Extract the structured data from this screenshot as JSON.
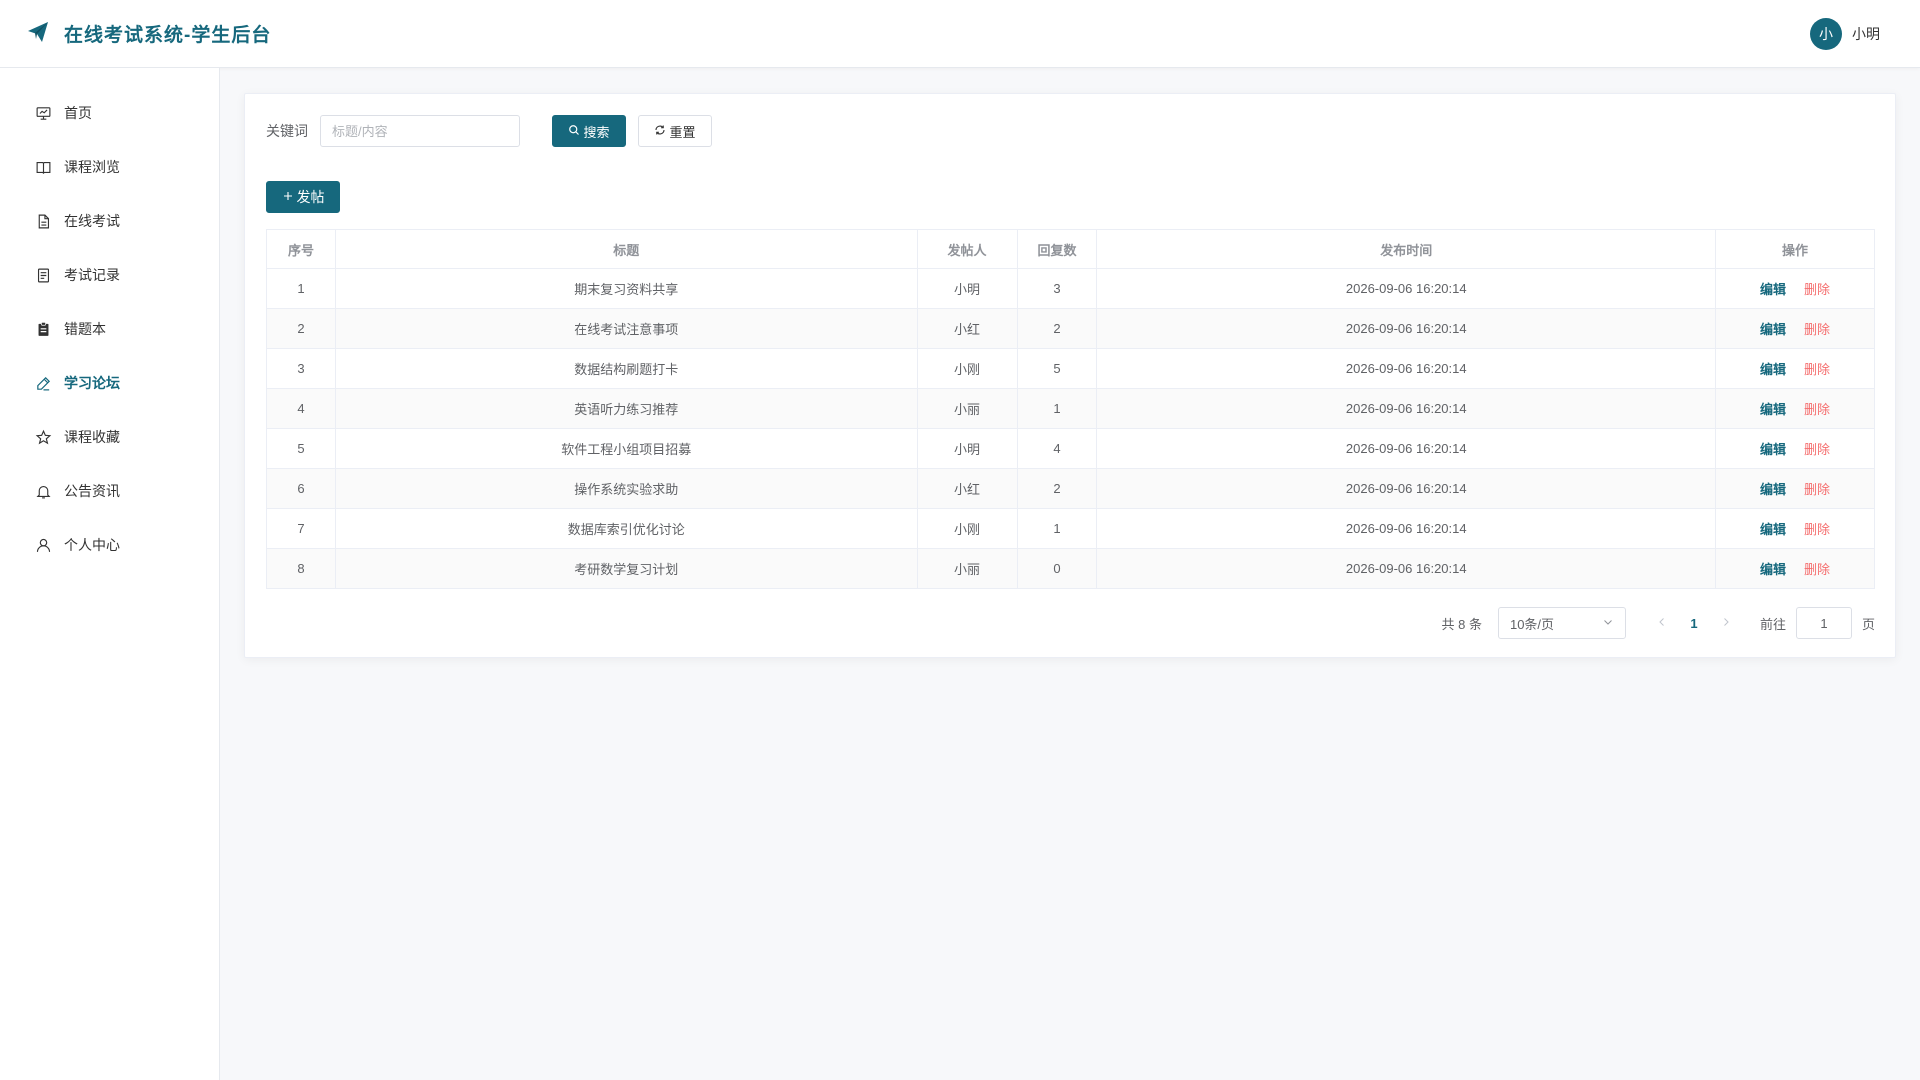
{
  "header": {
    "title": "在线考试系统-学生后台",
    "avatar_text": "小",
    "user_name": "小明"
  },
  "sidebar": {
    "items": [
      {
        "label": "首页",
        "icon": "home-icon"
      },
      {
        "label": "课程浏览",
        "icon": "book-icon"
      },
      {
        "label": "在线考试",
        "icon": "document-icon"
      },
      {
        "label": "考试记录",
        "icon": "record-icon"
      },
      {
        "label": "错题本",
        "icon": "notebook-icon"
      },
      {
        "label": "学习论坛",
        "icon": "pen-icon",
        "active": true
      },
      {
        "label": "课程收藏",
        "icon": "star-icon"
      },
      {
        "label": "公告资讯",
        "icon": "bell-icon"
      },
      {
        "label": "个人中心",
        "icon": "user-icon"
      }
    ]
  },
  "search": {
    "label": "关键词",
    "placeholder": "标题/内容",
    "value": "",
    "search_label": "搜索",
    "reset_label": "重置"
  },
  "toolbar": {
    "post_label": "发帖"
  },
  "table": {
    "columns": [
      "序号",
      "标题",
      "发帖人",
      "回复数",
      "发布时间",
      "操作"
    ],
    "edit_label": "编辑",
    "delete_label": "删除",
    "rows": [
      {
        "idx": "1",
        "title": "期末复习资料共享",
        "author": "小明",
        "replies": "3",
        "time": "2026-09-06 16:20:14"
      },
      {
        "idx": "2",
        "title": "在线考试注意事项",
        "author": "小红",
        "replies": "2",
        "time": "2026-09-06 16:20:14"
      },
      {
        "idx": "3",
        "title": "数据结构刷题打卡",
        "author": "小刚",
        "replies": "5",
        "time": "2026-09-06 16:20:14"
      },
      {
        "idx": "4",
        "title": "英语听力练习推荐",
        "author": "小丽",
        "replies": "1",
        "time": "2026-09-06 16:20:14"
      },
      {
        "idx": "5",
        "title": "软件工程小组项目招募",
        "author": "小明",
        "replies": "4",
        "time": "2026-09-06 16:20:14"
      },
      {
        "idx": "6",
        "title": "操作系统实验求助",
        "author": "小红",
        "replies": "2",
        "time": "2026-09-06 16:20:14"
      },
      {
        "idx": "7",
        "title": "数据库索引优化讨论",
        "author": "小刚",
        "replies": "1",
        "time": "2026-09-06 16:20:14"
      },
      {
        "idx": "8",
        "title": "考研数学复习计划",
        "author": "小丽",
        "replies": "0",
        "time": "2026-09-06 16:20:14"
      }
    ]
  },
  "pagination": {
    "total": "共 8 条",
    "page_size": "10条/页",
    "current_page": "1",
    "goto_label": "前往",
    "goto_value": "1",
    "page_unit": "页"
  },
  "colors": {
    "primary": "#16687d",
    "danger": "#f56c6c"
  }
}
